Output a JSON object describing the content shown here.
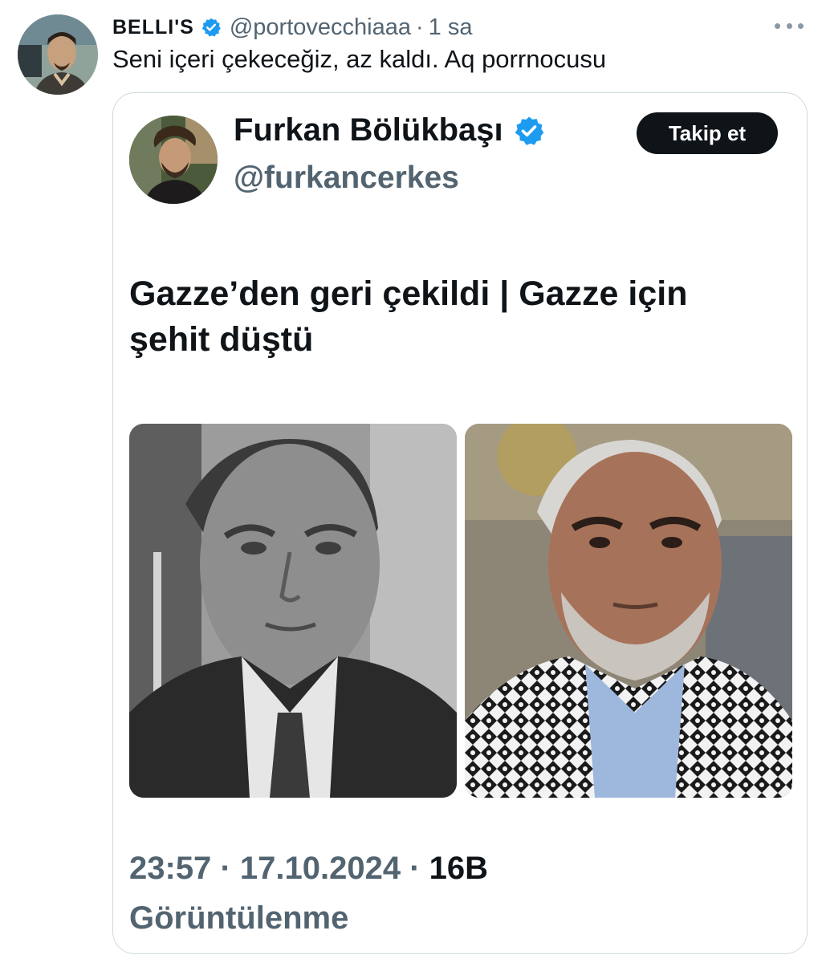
{
  "tweet": {
    "display_name": "BELLI'S",
    "handle": "@portovecchiaaa",
    "separator": "·",
    "time": "1 sa",
    "text": "Seni içeri çekeceğiz, az kaldı. Aq porrnocusu"
  },
  "quoted": {
    "display_name": "Furkan Bölükbaşı",
    "handle": "@furkancerkes",
    "follow_label": "Takip et",
    "headline": "Gazze’den geri çekildi | Gazze için şehit düştü",
    "time": "23:57",
    "separator": "·",
    "date": "17.10.2024",
    "views_count": "16B",
    "views_label": "Görüntülenme"
  },
  "colors": {
    "verified_blue": "#1d9bf0",
    "secondary_text": "#536471",
    "primary_text": "#0f1419",
    "border": "#cfd9de"
  },
  "icons": {
    "verified": "verified-badge-icon",
    "more": "more-horizontal-icon"
  }
}
